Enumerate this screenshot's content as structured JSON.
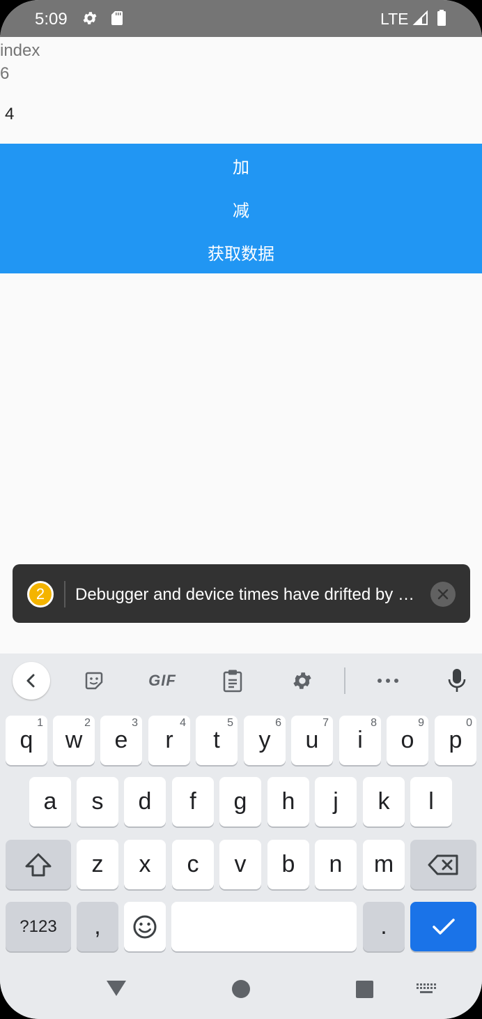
{
  "status_bar": {
    "time": "5:09",
    "network": "LTE"
  },
  "app": {
    "label_index": "index",
    "index_value": "6",
    "count_value": "4",
    "buttons": {
      "add": "加",
      "subtract": "减",
      "fetch": "获取数据"
    }
  },
  "toast": {
    "badge_count": "2",
    "message": "Debugger and device times have drifted by …"
  },
  "keyboard": {
    "toolbar": {
      "gif_label": "GIF"
    },
    "row1": [
      {
        "key": "q",
        "sup": "1"
      },
      {
        "key": "w",
        "sup": "2"
      },
      {
        "key": "e",
        "sup": "3"
      },
      {
        "key": "r",
        "sup": "4"
      },
      {
        "key": "t",
        "sup": "5"
      },
      {
        "key": "y",
        "sup": "6"
      },
      {
        "key": "u",
        "sup": "7"
      },
      {
        "key": "i",
        "sup": "8"
      },
      {
        "key": "o",
        "sup": "9"
      },
      {
        "key": "p",
        "sup": "0"
      }
    ],
    "row2": [
      "a",
      "s",
      "d",
      "f",
      "g",
      "h",
      "j",
      "k",
      "l"
    ],
    "row3": [
      "z",
      "x",
      "c",
      "v",
      "b",
      "n",
      "m"
    ],
    "symbols_label": "?123",
    "comma_label": ",",
    "period_label": "."
  },
  "colors": {
    "accent": "#2196f3",
    "status_bar": "#757575",
    "toast_bg": "#323232",
    "enter_key": "#1a73e8"
  }
}
